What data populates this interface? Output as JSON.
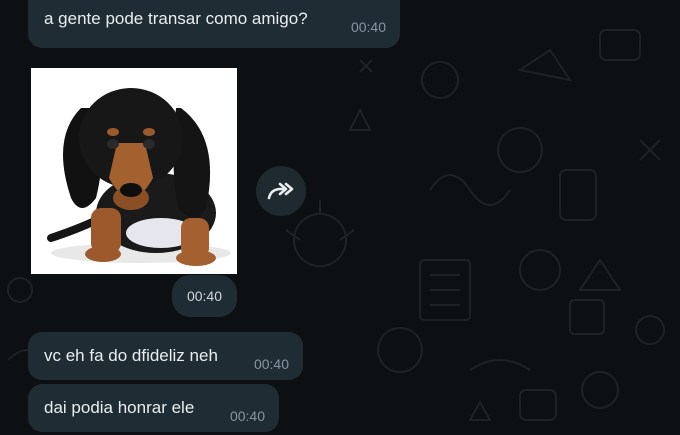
{
  "messages": [
    {
      "text": "a gente pode transar como amigo?",
      "time": "00:40"
    },
    {
      "type": "image",
      "image_description": "black and tan dachshund puppy",
      "time": "00:40"
    },
    {
      "text": "vc eh fa do dfideliz neh",
      "time": "00:40"
    },
    {
      "text": "dai podia honrar ele",
      "time": "00:40"
    }
  ],
  "icons": {
    "forward": "forward-icon"
  },
  "colors": {
    "background": "#0d1012",
    "bubble": "#202c33",
    "text": "#e9edef",
    "time": "#8696a0"
  }
}
